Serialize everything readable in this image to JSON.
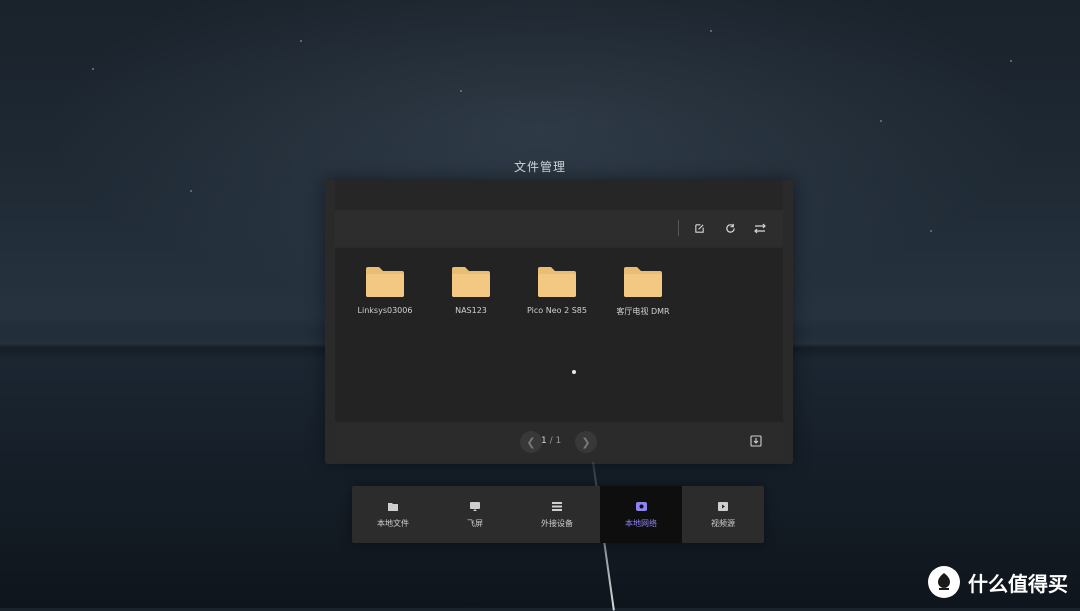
{
  "window": {
    "title": "文件管理"
  },
  "toolbar": {
    "icons": [
      "edit-icon",
      "refresh-icon",
      "sort-icon"
    ]
  },
  "folders": [
    {
      "name": "Linksys03006"
    },
    {
      "name": "NAS123"
    },
    {
      "name": "Pico Neo 2 S85"
    },
    {
      "name": "客厅电视 DMR"
    }
  ],
  "pager": {
    "current": "1",
    "separator": "/",
    "total": "1"
  },
  "dock": {
    "items": [
      {
        "label": "本地文件",
        "icon": "folder-icon",
        "active": false
      },
      {
        "label": "飞屏",
        "icon": "cast-icon",
        "active": false
      },
      {
        "label": "外接设备",
        "icon": "storage-icon",
        "active": false
      },
      {
        "label": "本地网络",
        "icon": "network-icon",
        "active": true
      },
      {
        "label": "视频源",
        "icon": "video-icon",
        "active": false
      }
    ]
  },
  "watermark": {
    "text": "什么值得买",
    "logo_glyph": "值"
  },
  "colors": {
    "folder": "#f2c883",
    "active_tab_text": "#8f83f2",
    "panel_bg": "#2a2a2a"
  }
}
